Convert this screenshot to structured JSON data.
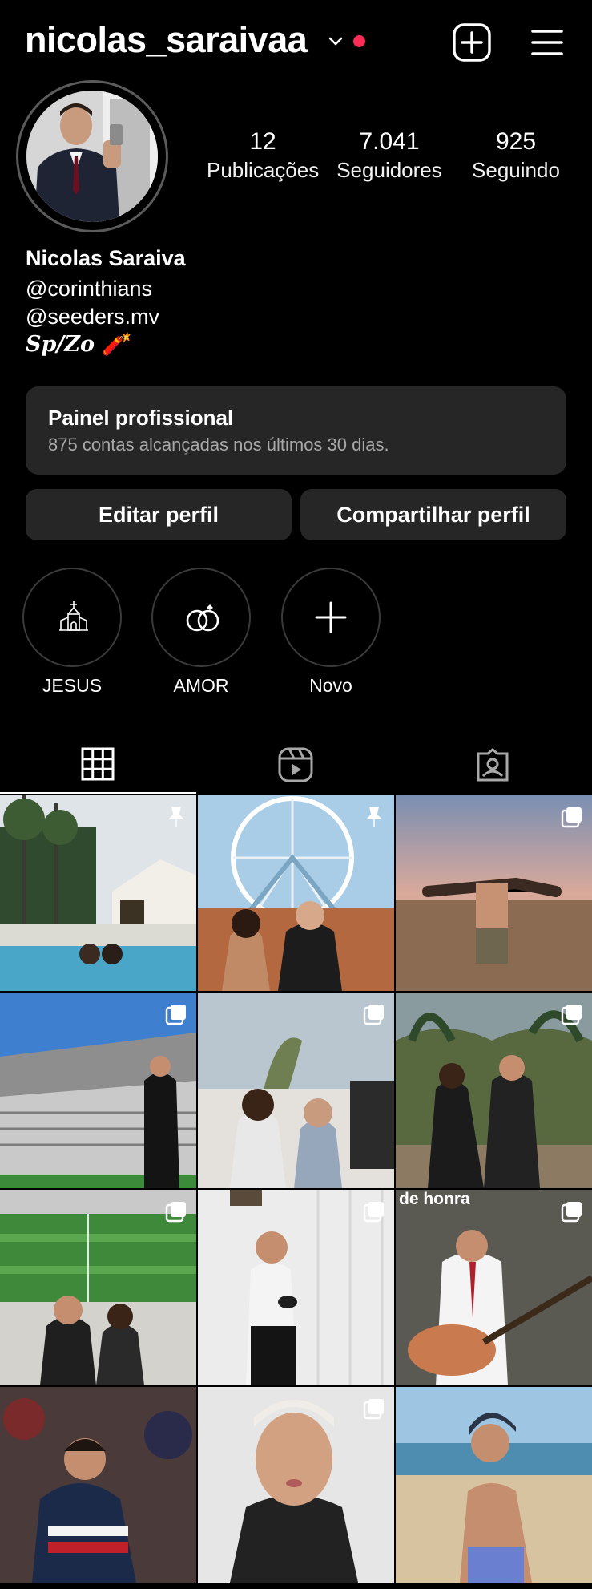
{
  "header": {
    "username": "nicolas_saraivaa",
    "icons": [
      "chevron-down-icon",
      "notification-dot",
      "create-post-icon",
      "menu-icon"
    ],
    "dot_color": "#ff2d55"
  },
  "stats": [
    {
      "value": "12",
      "label": "Publicações"
    },
    {
      "value": "7.041",
      "label": "Seguidores"
    },
    {
      "value": "925",
      "label": "Seguindo"
    }
  ],
  "profile": {
    "name": "Nicolas Saraiva",
    "bio_lines": [
      "@corinthians",
      "@seeders.mv",
      "Sp/Zo 🧨"
    ]
  },
  "dashboard": {
    "title": "Painel profissional",
    "subtitle": "875 contas alcançadas nos últimos 30 dias."
  },
  "actions": {
    "edit_label": "Editar perfil",
    "share_label": "Compartilhar perfil"
  },
  "highlights": [
    {
      "label": "JESUS",
      "icon": "church-icon"
    },
    {
      "label": "AMOR",
      "icon": "rings-icon"
    },
    {
      "label": "Novo",
      "icon": "plus-icon"
    }
  ],
  "tabs": [
    {
      "name": "posts",
      "icon": "grid-icon",
      "active": true
    },
    {
      "name": "reels",
      "icon": "reels-icon",
      "active": false
    },
    {
      "name": "tagged",
      "icon": "tagged-icon",
      "active": false
    }
  ],
  "posts": [
    {
      "badge": "pin-icon"
    },
    {
      "badge": "pin-icon"
    },
    {
      "badge": "carousel-icon"
    },
    {
      "badge": "carousel-icon"
    },
    {
      "badge": "carousel-icon"
    },
    {
      "badge": "carousel-icon"
    },
    {
      "badge": "carousel-icon"
    },
    {
      "badge": "carousel-icon"
    },
    {
      "badge": "carousel-icon",
      "overlay_text": "de honra"
    },
    {
      "badge": ""
    },
    {
      "badge": "carousel-icon"
    },
    {
      "badge": ""
    }
  ],
  "colors": {
    "background": "#000000",
    "surface": "#262626",
    "muted_text": "#a8a8a8"
  }
}
